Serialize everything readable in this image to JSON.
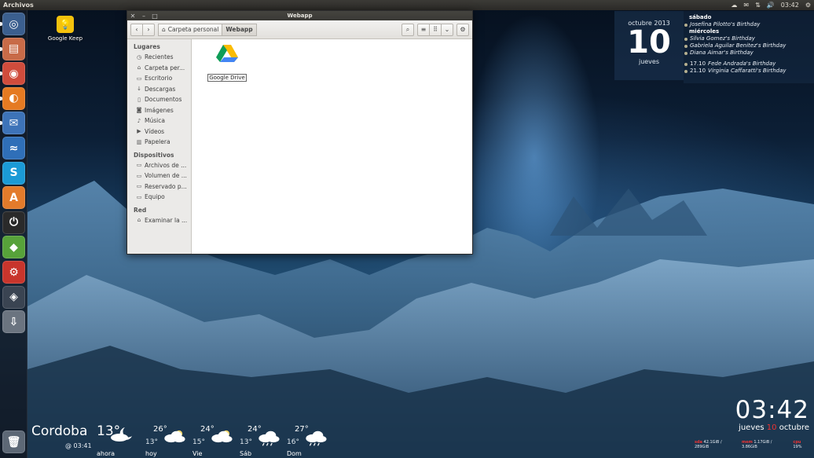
{
  "top_panel": {
    "app_title": "Archivos",
    "time": "03:42"
  },
  "launcher": {
    "items": [
      {
        "name": "dash",
        "icon": "ubuntu-logo-icon",
        "color": "#3b5f8f"
      },
      {
        "name": "files",
        "icon": "files-icon",
        "color": "#c86b48"
      },
      {
        "name": "chrome",
        "icon": "chrome-icon",
        "color": "#d04c3c"
      },
      {
        "name": "firefox",
        "icon": "firefox-icon",
        "color": "#e57a22"
      },
      {
        "name": "thunderbird",
        "icon": "thunderbird-icon",
        "color": "#3d73b8"
      },
      {
        "name": "chat",
        "icon": "chat-icon",
        "color": "#2f6fb8"
      },
      {
        "name": "skype",
        "icon": "skype-icon",
        "color": "#1b9ad6"
      },
      {
        "name": "software-center",
        "icon": "software-center-icon",
        "color": "#e37b2b"
      },
      {
        "name": "power",
        "icon": "power-icon",
        "color": "#2a2a2a"
      },
      {
        "name": "green-app",
        "icon": "green-app-icon",
        "color": "#57a23a"
      },
      {
        "name": "settings",
        "icon": "settings-tools-icon",
        "color": "#c8352c"
      },
      {
        "name": "steam",
        "icon": "steam-icon",
        "color": "#3a4452"
      },
      {
        "name": "installer",
        "icon": "installer-icon",
        "color": "#6b7480"
      },
      {
        "name": "trash",
        "icon": "trash-icon",
        "color": "#5d6876"
      }
    ]
  },
  "desktop": {
    "icon_label": "Google Keep"
  },
  "window": {
    "title": "Webapp",
    "breadcrumbs": [
      "Carpeta personal",
      "Webapp"
    ],
    "sidebar": {
      "sections": [
        {
          "title": "Lugares",
          "items": [
            {
              "label": "Recientes",
              "icon": "clock-icon"
            },
            {
              "label": "Carpeta per...",
              "icon": "home-icon"
            },
            {
              "label": "Escritorio",
              "icon": "desktop-icon"
            },
            {
              "label": "Descargas",
              "icon": "download-icon"
            },
            {
              "label": "Documentos",
              "icon": "document-icon"
            },
            {
              "label": "Imágenes",
              "icon": "camera-icon"
            },
            {
              "label": "Música",
              "icon": "music-icon"
            },
            {
              "label": "Vídeos",
              "icon": "video-icon"
            },
            {
              "label": "Papelera",
              "icon": "trash-icon"
            }
          ]
        },
        {
          "title": "Dispositivos",
          "items": [
            {
              "label": "Archivos de ...",
              "icon": "drive-icon"
            },
            {
              "label": "Volumen de ...",
              "icon": "drive-icon"
            },
            {
              "label": "Reservado p...",
              "icon": "drive-icon"
            },
            {
              "label": "Equipo",
              "icon": "computer-icon"
            }
          ]
        },
        {
          "title": "Red",
          "items": [
            {
              "label": "Examinar la ...",
              "icon": "network-icon"
            }
          ]
        }
      ]
    },
    "files": [
      {
        "name": "Google Drive",
        "icon": "google-drive-icon"
      }
    ]
  },
  "calendar": {
    "month_year": "octubre 2013",
    "day": "10",
    "weekday": "jueves",
    "events": [
      {
        "type": "day",
        "text": "sábado"
      },
      {
        "type": "event",
        "text": "Josefina Pilotto's Birthday"
      },
      {
        "type": "day",
        "text": "miércoles"
      },
      {
        "type": "event",
        "text": "Silvia Gomez's Birthday"
      },
      {
        "type": "event",
        "text": "Gabriela Aguilar Benitez's Birthday"
      },
      {
        "type": "event",
        "text": "Diana Aimar's Birthday"
      },
      {
        "type": "gap",
        "text": ""
      },
      {
        "type": "dated",
        "date": "17.10",
        "text": "Fede Andrada's Birthday"
      },
      {
        "type": "dated",
        "date": "21.10",
        "text": "Virginia Caffaratti's Birthday"
      }
    ]
  },
  "weather": {
    "city": "Cordoba",
    "updated": "@ 03:41",
    "current": {
      "temp": "13°",
      "label": "ahora"
    },
    "forecast": [
      {
        "hi": "26°",
        "lo": "13°",
        "day": "hoy"
      },
      {
        "hi": "24°",
        "lo": "15°",
        "day": "Vie"
      },
      {
        "hi": "24°",
        "lo": "13°",
        "day": "Sáb"
      },
      {
        "hi": "27°",
        "lo": "16°",
        "day": "Dom"
      }
    ]
  },
  "clock": {
    "time": "03:42",
    "date_prefix": "jueves",
    "date_day": "10",
    "date_suffix": "octubre"
  },
  "sysinfo": [
    {
      "tag": "sda",
      "value": "42.1GiB / 289GiB"
    },
    {
      "tag": "mem",
      "value": "1.17GiB / 3.86GiB"
    },
    {
      "tag": "cpu",
      "value": "19%"
    }
  ]
}
